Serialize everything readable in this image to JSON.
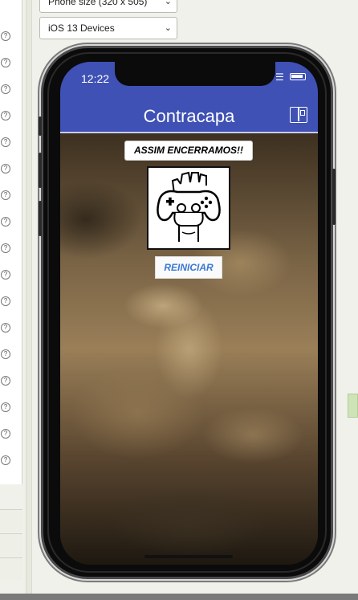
{
  "toolbar": {
    "device_select": "Phone size (320 x 505)",
    "os_select": "iOS 13 Devices"
  },
  "properties": {
    "help_symbol": "?"
  },
  "phone": {
    "status_time": "12:22",
    "header_title": "Contracapa",
    "banner_text": "ASSIM ENCERRAMOS!!",
    "image_description_icon": "gamepad-hand-icon",
    "restart_label": "REINICIAR"
  },
  "colors": {
    "header": "#3f51b5",
    "restart_text": "#3a78d6"
  }
}
